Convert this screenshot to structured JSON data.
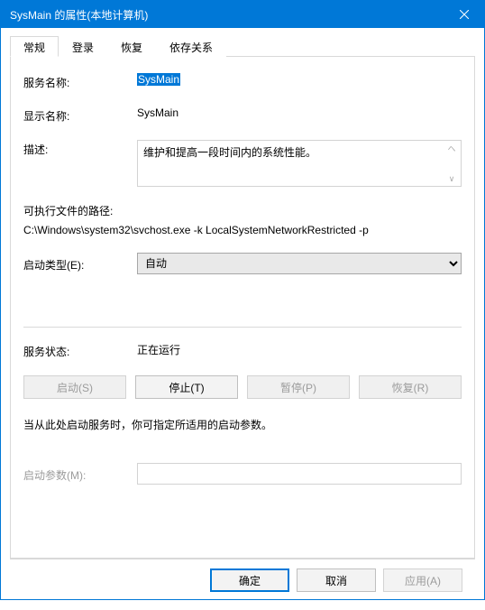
{
  "titlebar": {
    "text": "SysMain 的属性(本地计算机)"
  },
  "tabs": {
    "general": "常规",
    "logon": "登录",
    "recovery": "恢复",
    "dependencies": "依存关系"
  },
  "labels": {
    "service_name": "服务名称:",
    "display_name": "显示名称:",
    "description": "描述:",
    "exe_path": "可执行文件的路径:",
    "startup_type": "启动类型(E):",
    "service_status": "服务状态:",
    "start_params": "启动参数(M):"
  },
  "values": {
    "service_name": "SysMain",
    "display_name": "SysMain",
    "description": "维护和提高一段时间内的系统性能。",
    "exe_path": "C:\\Windows\\system32\\svchost.exe -k LocalSystemNetworkRestricted -p",
    "startup_selected": "自动",
    "service_status": "正在运行"
  },
  "startup_options": [
    "自动"
  ],
  "buttons": {
    "start": "启动(S)",
    "stop": "停止(T)",
    "pause": "暂停(P)",
    "resume": "恢复(R)",
    "ok": "确定",
    "cancel": "取消",
    "apply": "应用(A)"
  },
  "hint": "当从此处启动服务时，你可指定所适用的启动参数。"
}
